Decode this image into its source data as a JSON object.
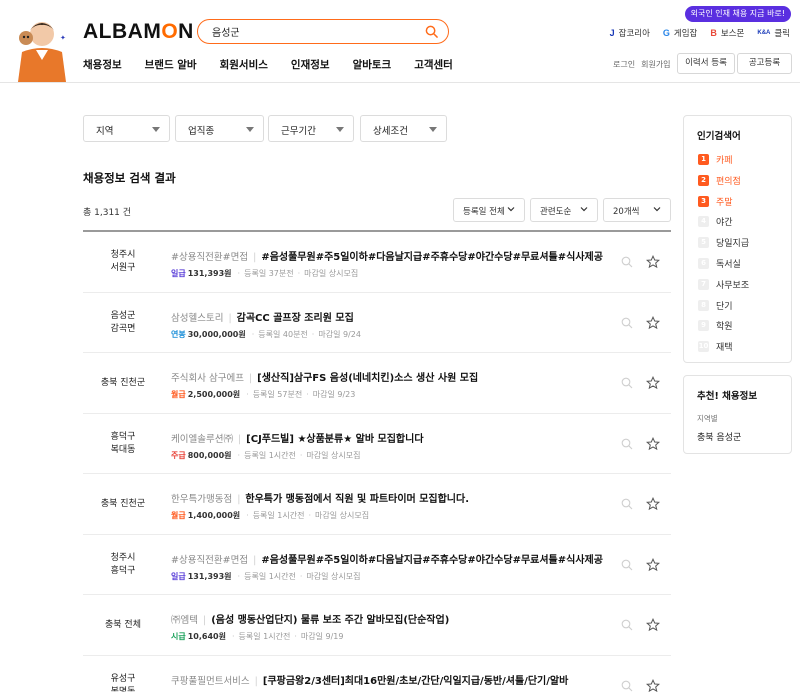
{
  "header": {
    "logo_prefix": "ALBAM",
    "logo_accent": "O",
    "logo_suffix": "N",
    "search_value": "음성군",
    "promo": "외국인 인재 채용 지금 바로!",
    "family_sites": [
      {
        "mark": "J",
        "label": "잡코리아",
        "color": "#1a3ab8"
      },
      {
        "mark": "G",
        "label": "게임잡",
        "color": "#2a86e8"
      },
      {
        "mark": "B",
        "label": "보스몬",
        "color": "#e84a3a"
      },
      {
        "mark": "K&A",
        "label": "클릭",
        "color": "#1a3ab8"
      }
    ],
    "nav": [
      "채용정보",
      "브랜드 알바",
      "회원서비스",
      "인재정보",
      "알바토크",
      "고객센터"
    ],
    "login": "로그인",
    "signup": "회원가입",
    "resume_button": "이력서 등록",
    "post_button": "공고등록"
  },
  "filters": [
    "지역",
    "업직종",
    "근무기간",
    "상세조건"
  ],
  "results": {
    "title": "채용정보 검색 결과",
    "total": "총 1,311 건",
    "sort_options": [
      "등록일 전체",
      "관련도순",
      "20개씩"
    ]
  },
  "jobs": [
    {
      "loc1": "청주시",
      "loc2": "서원구",
      "company": "#상용직전환#면접",
      "title": "#음성풀무원#주5일이하#다음날지급#주휴수당#야간수당#무료셔틀#식사제공",
      "pay_type": "일급",
      "pay_color": "#5a3fd8",
      "pay": "131,393원",
      "posted": "등록일 37분전",
      "deadline": "마감일 상시모집"
    },
    {
      "loc1": "음성군",
      "loc2": "감곡면",
      "company": "삼성헬스토리",
      "title": "감곡CC 골프장 조리원 모집",
      "pay_type": "연봉",
      "pay_color": "#1c8fd8",
      "pay": "30,000,000원",
      "posted": "등록일 40분전",
      "deadline": "마감일 9/24"
    },
    {
      "loc1": "충북 진천군",
      "loc2": "",
      "company": "주식회사 삼구에프",
      "title": "[생산직]삼구FS 음성(네네치킨)소스 생산 사원 모집",
      "pay_type": "월급",
      "pay_color": "#ff5a1f",
      "pay": "2,500,000원",
      "posted": "등록일 57분전",
      "deadline": "마감일 9/23"
    },
    {
      "loc1": "흥덕구",
      "loc2": "복대동",
      "company": "케이엘솔루션㈜",
      "title": "[CJ푸드빌] ★상품분류★ 알바 모집합니다",
      "pay_type": "주급",
      "pay_color": "#e8443a",
      "pay": "800,000원",
      "posted": "등록일 1시간전",
      "deadline": "마감일 상시모집"
    },
    {
      "loc1": "충북 진천군",
      "loc2": "",
      "company": "한우특가맹동점",
      "title": "한우특가 맹동점에서 직원 및 파트타이머 모집합니다.",
      "pay_type": "월급",
      "pay_color": "#ff5a1f",
      "pay": "1,400,000원",
      "posted": "등록일 1시간전",
      "deadline": "마감일 상시모집"
    },
    {
      "loc1": "청주시",
      "loc2": "흥덕구",
      "company": "#상용직전환#면접",
      "title": "#음성풀무원#주5일이하#다음날지급#주휴수당#야간수당#무료셔틀#식사제공",
      "pay_type": "일급",
      "pay_color": "#5a3fd8",
      "pay": "131,393원",
      "posted": "등록일 1시간전",
      "deadline": "마감일 상시모집"
    },
    {
      "loc1": "충북 전체",
      "loc2": "",
      "company": "㈜엠텍",
      "title": "(음성 맹동산업단지) 물류 보조 주간 알바모집(단순작업)",
      "pay_type": "시급",
      "pay_color": "#18a058",
      "pay": "10,640원",
      "posted": "등록일 1시간전",
      "deadline": "마감일 9/19"
    },
    {
      "loc1": "유성구",
      "loc2": "봉명동",
      "company": "쿠팡풀필먼트서비스",
      "title": "[쿠팡금왕2/3센터]최대16만원/초보/간단/익일지급/동반/셔틀/단기/알바",
      "pay_type": "",
      "pay_color": "#333333",
      "pay": "",
      "posted": "",
      "deadline": ""
    }
  ],
  "sidebar": {
    "popular_title": "인기검색어",
    "keywords": [
      {
        "rank": "1",
        "label": "카페"
      },
      {
        "rank": "2",
        "label": "편의점"
      },
      {
        "rank": "3",
        "label": "주말"
      },
      {
        "rank": "4",
        "label": "야간"
      },
      {
        "rank": "5",
        "label": "당일지급"
      },
      {
        "rank": "6",
        "label": "독서실"
      },
      {
        "rank": "7",
        "label": "사무보조"
      },
      {
        "rank": "8",
        "label": "단기"
      },
      {
        "rank": "9",
        "label": "학원"
      },
      {
        "rank": "10",
        "label": "재택"
      }
    ],
    "recommend_title": "추천! 채용정보",
    "recommend_sub": "지역별",
    "recommend_value": "충북 음성군"
  }
}
